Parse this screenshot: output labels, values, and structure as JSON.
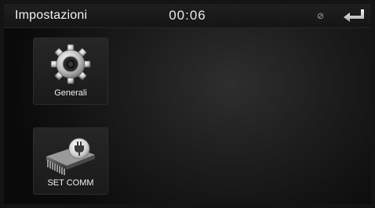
{
  "header": {
    "title": "Impostazioni",
    "clock": "00:06",
    "status_icon": "no-signal-icon",
    "back_icon": "return-arrow-icon"
  },
  "menu": {
    "items": [
      {
        "label": "Generali",
        "icon": "gear-icon"
      },
      {
        "label": "SET COMM",
        "icon": "chip-plug-icon"
      }
    ]
  },
  "colors": {
    "background": "#1d1d1d",
    "text": "#f2f2f2",
    "accent": "#cfcfcf"
  }
}
